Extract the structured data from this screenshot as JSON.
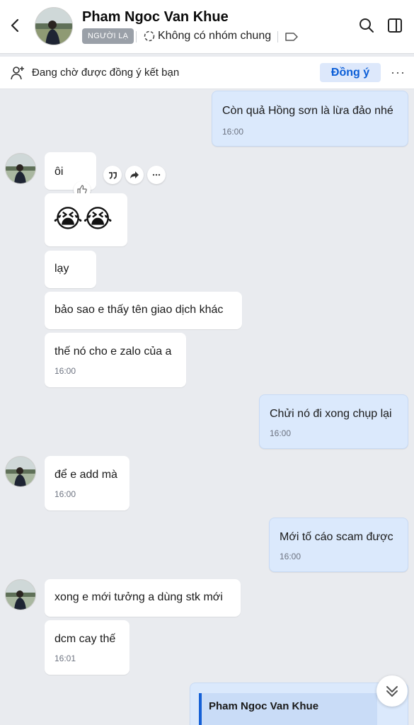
{
  "header": {
    "title": "Pham Ngoc Van Khue",
    "badge": "NGƯỜI LẠ",
    "group_text": "Không có nhóm chung"
  },
  "friend_request": {
    "text": "Đang chờ được đồng ý kết bạn",
    "accept_label": "Đồng ý",
    "more_label": "···"
  },
  "messages": [
    {
      "dir": "out",
      "text": "Còn quả Hồng sơn là lừa đảo nhé",
      "time": "16:00"
    },
    {
      "dir": "in",
      "text": "ôi",
      "time": ""
    },
    {
      "dir": "in",
      "text": "😭😭",
      "time": ""
    },
    {
      "dir": "in",
      "text": "lạy",
      "time": ""
    },
    {
      "dir": "in",
      "text": "bảo sao e thấy tên giao dịch khác",
      "time": ""
    },
    {
      "dir": "in",
      "text": "thế nó cho e zalo của a",
      "time": "16:00"
    },
    {
      "dir": "out",
      "text": "Chửi nó đi xong chụp lại",
      "time": "16:00"
    },
    {
      "dir": "in",
      "text": "để e add mà",
      "time": "16:00"
    },
    {
      "dir": "out",
      "text": "Mới tố cáo scam được",
      "time": "16:00"
    },
    {
      "dir": "in",
      "text": "xong e mới tưởng a dùng stk mới",
      "time": ""
    },
    {
      "dir": "in",
      "text": "dcm cay thế",
      "time": "16:01"
    }
  ],
  "quoted_reply": {
    "author": "Pham Ngoc Van Khue"
  },
  "icons": {
    "back": "chevron-left-icon",
    "search": "search-icon",
    "panel": "side-panel-icon",
    "quote": "quote-icon",
    "forward": "forward-icon",
    "more": "more-horizontal-icon",
    "like": "thumbs-up-icon",
    "scroll": "double-chevron-down-icon"
  },
  "colors": {
    "accent": "#0b5ed7",
    "outgoing_bubble": "#dbe9fc",
    "incoming_bubble": "#ffffff",
    "background": "#e9ebef"
  }
}
